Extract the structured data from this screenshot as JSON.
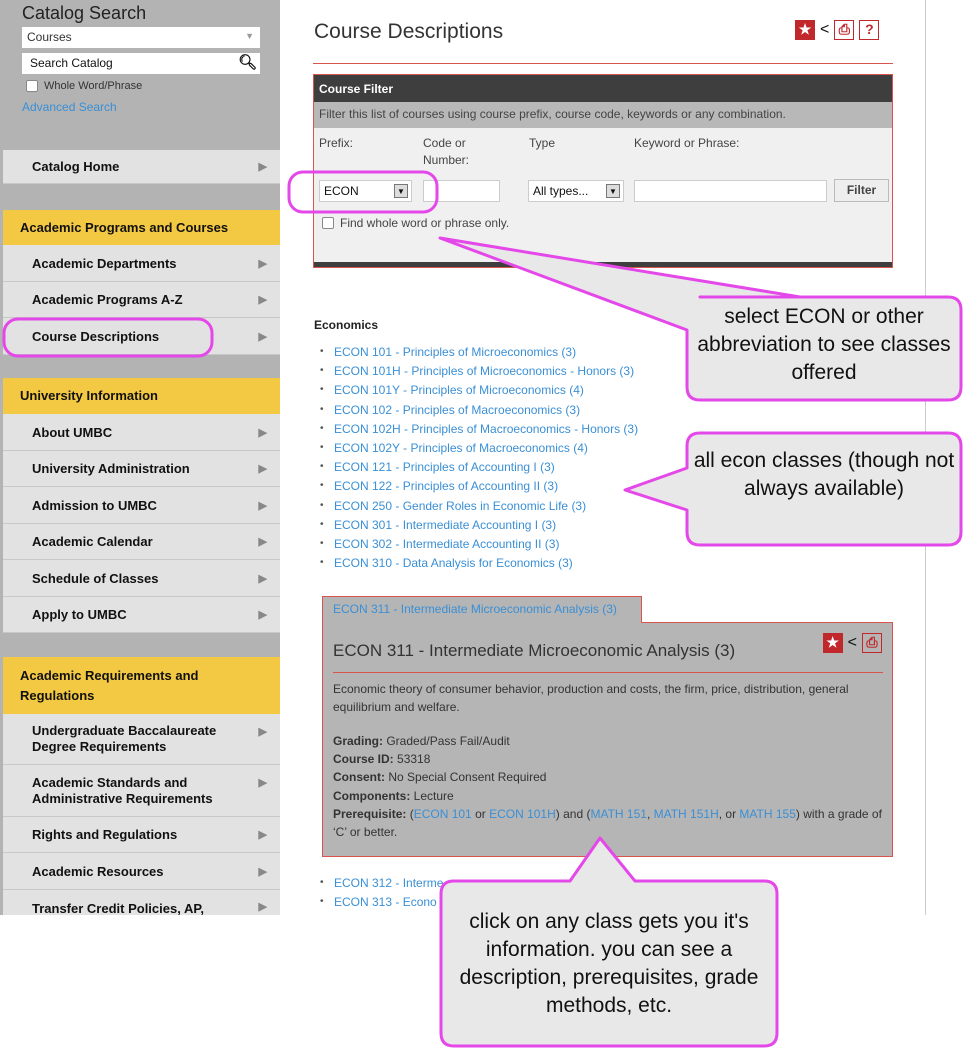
{
  "sidebar": {
    "title": "Catalog Search",
    "scope_select": "Courses",
    "search_placeholder": "Search Catalog",
    "whole_word_label": "Whole Word/Phrase",
    "advanced_search": "Advanced Search",
    "catalog_home": "Catalog Home",
    "groups": [
      {
        "heading": "Academic Programs and Courses",
        "items": [
          "Academic Departments",
          "Academic Programs A-Z",
          "Course Descriptions"
        ]
      },
      {
        "heading": "University Information",
        "items": [
          "About UMBC",
          "University Administration",
          "Admission to UMBC",
          "Academic Calendar",
          "Schedule of Classes",
          "Apply to UMBC"
        ]
      },
      {
        "heading": "Academic Requirements and Regulations",
        "items": [
          "Undergraduate Baccalaureate Degree Requirements",
          "Academic Standards and Administrative Requirements",
          "Rights and Regulations",
          "Academic Resources",
          "Transfer Credit Policies, AP,"
        ]
      }
    ]
  },
  "main": {
    "title": "Course Descriptions",
    "filter": {
      "heading": "Course Filter",
      "description": "Filter this list of courses using course prefix, course code, keywords or any combination.",
      "prefix_label": "Prefix:",
      "code_label": "Code or Number:",
      "type_label": "Type",
      "keyword_label": "Keyword or Phrase:",
      "prefix_value": "ECON",
      "type_value": "All types...",
      "filter_button": "Filter",
      "whole_word_label": "Find whole word or phrase only."
    },
    "section": "Economics",
    "courses": [
      "ECON 101 - Principles of Microeconomics (3)",
      "ECON 101H - Principles of Microeconomics - Honors (3)",
      "ECON 101Y - Principles of Microeconomics (4)",
      "ECON 102 - Principles of Macroeconomics (3)",
      "ECON 102H - Principles of Macroeconomics - Honors (3)",
      "ECON 102Y - Principles of Macroeconomics (4)",
      "ECON 121 - Principles of Accounting I (3)",
      "ECON 122 - Principles of Accounting II (3)",
      "ECON 250 - Gender Roles in Economic Life (3)",
      "ECON 301 - Intermediate Accounting I (3)",
      "ECON 302 - Intermediate Accounting II (3)",
      "ECON 310 - Data Analysis for Economics (3)"
    ],
    "detail": {
      "tab": "ECON 311 - Intermediate Microeconomic Analysis (3)",
      "title": "ECON 311 - Intermediate Microeconomic Analysis (3)",
      "description": "Economic theory of consumer behavior, production and costs, the firm, price, distribution, general equilibrium and welfare.",
      "grading_label": "Grading:",
      "grading": "Graded/Pass Fail/Audit",
      "id_label": "Course ID:",
      "id": "53318",
      "consent_label": "Consent:",
      "consent": "No Special Consent Required",
      "components_label": "Components:",
      "components": "Lecture",
      "prereq_label": "Prerequisite:",
      "prereq_parts": [
        "(",
        "ECON 101",
        " or ",
        "ECON 101H",
        ") and (",
        "MATH 151",
        ", ",
        "MATH 151H",
        ", or ",
        "MATH 155",
        ") with a grade of ‘C’ or better."
      ]
    },
    "courses_after": [
      "ECON 312 - Interme",
      "ECON 313 - Econo"
    ]
  },
  "callouts": [
    "select ECON or other abbreviation to see classes offered",
    "all econ classes (though not always available)",
    "click on any class gets you it's information.  you can see a description, prerequisites, grade methods, etc."
  ],
  "colors": {
    "accent_red": "#c0282b",
    "link": "#3a8fd6",
    "heading_yellow": "#f3c842",
    "annotation_pink": "#e448e8"
  }
}
